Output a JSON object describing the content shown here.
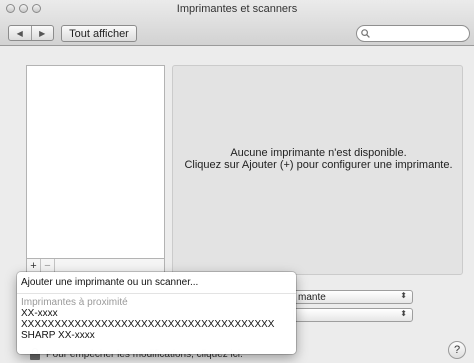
{
  "window": {
    "title": "Imprimantes et scanners"
  },
  "toolbar": {
    "back_glyph": "◀",
    "forward_glyph": "▶",
    "show_all_label": "Tout afficher",
    "search_placeholder": ""
  },
  "list": {
    "add_label": "+",
    "remove_label": "−"
  },
  "detail": {
    "empty_line1": "Aucune imprimante n'est disponible.",
    "empty_line2": "Cliquez sur Ajouter (+) pour configurer une imprimante."
  },
  "popups": {
    "default_printer_value": "mante",
    "default_paper_value": "",
    "arrows": "⬍"
  },
  "lock": {
    "text": "Pour empêcher les modifications, cliquez ici."
  },
  "help": {
    "label": "?"
  },
  "menu": {
    "add_item": "Ajouter une imprimante ou un scanner...",
    "nearby_heading": "Imprimantes à proximité",
    "printers": [
      "XX-xxxx",
      "XXXXXXXXXXXXXXXXXXXXXXXXXXXXXXXXXXXXXX",
      "SHARP XX-xxxx"
    ]
  }
}
